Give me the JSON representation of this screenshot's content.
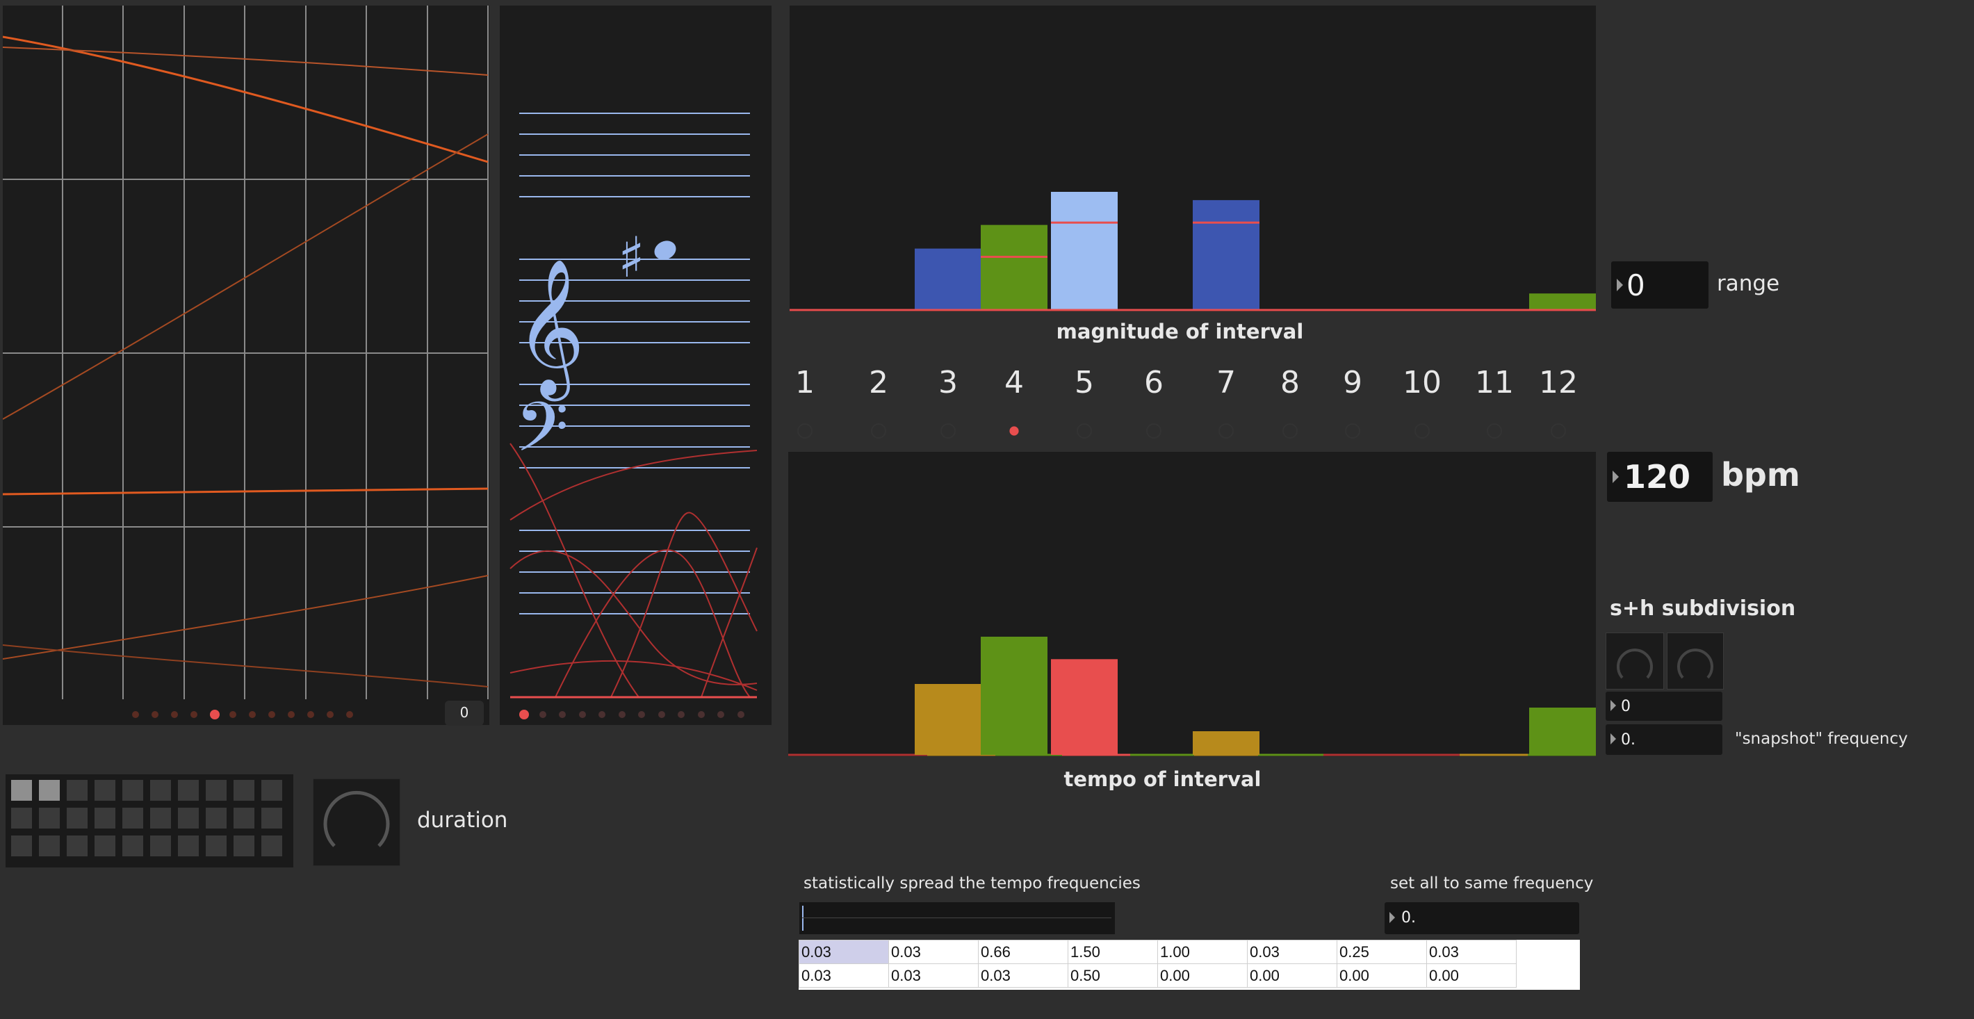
{
  "colors": {
    "orange": "#e05a20",
    "staff_blue": "#9ab8ee",
    "bar_blue": "#3d56b0",
    "bar_lightblue": "#9dbdf2",
    "bar_green": "#5e9217",
    "bar_gold": "#b78a1c",
    "bar_red": "#e84e4e",
    "background": "#2e2e2e",
    "panel": "#1c1c1c"
  },
  "left_plot": {
    "value_box": "0",
    "page_dots": 12,
    "active_page": 5
  },
  "score": {
    "page_dots": 12,
    "active_page": 1
  },
  "magnitude_chart": {
    "label": "magnitude of interval",
    "bars": [
      {
        "interval": 3,
        "value": 0.52,
        "color": "#3d56b0"
      },
      {
        "interval": 4,
        "value": 0.72,
        "color": "#5e9217",
        "marker": 0.45
      },
      {
        "interval": 5,
        "value": 1.0,
        "color": "#9dbdf2",
        "marker": 0.74
      },
      {
        "interval": 7,
        "value": 0.93,
        "color": "#3d56b0",
        "marker": 0.74
      },
      {
        "interval": 12,
        "value": 0.14,
        "color": "#5e9217"
      }
    ]
  },
  "interval_numbers": [
    "1",
    "2",
    "3",
    "4",
    "5",
    "6",
    "7",
    "8",
    "9",
    "10",
    "11",
    "12"
  ],
  "selected_interval": 4,
  "tempo_chart": {
    "label": "tempo of interval",
    "bars": [
      {
        "interval": 3,
        "value": 0.6,
        "color": "#b78a1c"
      },
      {
        "interval": 4,
        "value": 1.0,
        "color": "#5e9217"
      },
      {
        "interval": 5,
        "value": 0.81,
        "color": "#e84e4e"
      },
      {
        "interval": 7,
        "value": 0.2,
        "color": "#b78a1c"
      },
      {
        "interval": 12,
        "value": 0.4,
        "color": "#5e9217"
      }
    ]
  },
  "range": {
    "value": "0",
    "label": "range"
  },
  "bpm": {
    "value": "120",
    "label": "bpm"
  },
  "sh_subdivision": {
    "label": "s+h subdivision",
    "value1": "0",
    "value2": "0."
  },
  "snapshot_label": "\"snapshot\" frequency",
  "duration_label": "duration",
  "matrix": {
    "rows": 3,
    "cols": 10,
    "on": [
      [
        0,
        0
      ],
      [
        0,
        1
      ]
    ]
  },
  "spread": {
    "label": "statistically spread the tempo frequencies"
  },
  "same_freq": {
    "label": "set all to same frequency",
    "value": "0."
  },
  "cell_table": {
    "rows": [
      [
        "0.03",
        "0.03",
        "0.66",
        "1.50",
        "1.00",
        "0.03",
        "0.25",
        "0.03"
      ],
      [
        "0.03",
        "0.03",
        "0.03",
        "0.50",
        "0.00",
        "0.00",
        "0.00",
        "0.00"
      ]
    ],
    "selected": [
      0,
      0
    ]
  }
}
